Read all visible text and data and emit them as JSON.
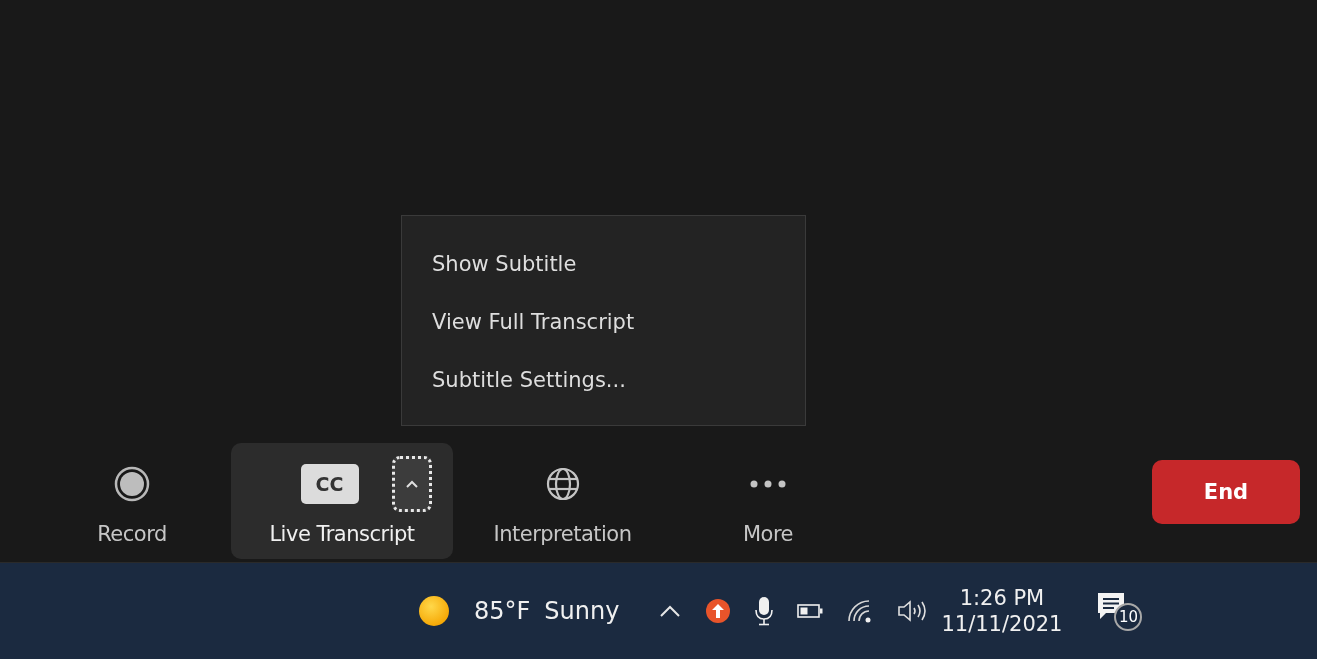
{
  "menu": {
    "items": [
      {
        "label": "Show Subtitle"
      },
      {
        "label": "View Full Transcript"
      },
      {
        "label": "Subtitle Settings..."
      }
    ]
  },
  "toolbar": {
    "items": [
      {
        "kind": "record",
        "label": "Record",
        "active": false
      },
      {
        "kind": "cc",
        "label": "Live Transcript",
        "active": true,
        "icon_text": "CC",
        "menu_open": true
      },
      {
        "kind": "globe",
        "label": "Interpretation",
        "active": false
      },
      {
        "kind": "more",
        "label": "More",
        "active": false
      }
    ],
    "end_button": "End"
  },
  "taskbar": {
    "weather": {
      "temperature": "85°F",
      "condition": "Sunny"
    },
    "clock": {
      "time": "1:26 PM",
      "date": "11/11/2021"
    },
    "notifications": {
      "count": "10"
    }
  }
}
